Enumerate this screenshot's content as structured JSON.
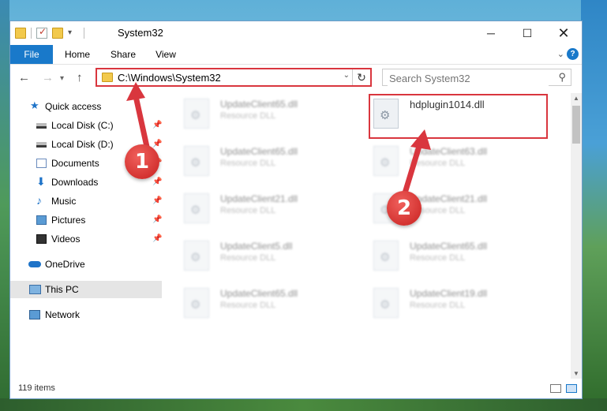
{
  "window": {
    "title": "System32",
    "quick_access_toolbar": [
      "folder-icon",
      "properties-icon",
      "new-folder-icon",
      "customize-icon"
    ]
  },
  "ribbon": {
    "tabs": [
      "File",
      "Home",
      "Share",
      "View"
    ],
    "help": "?"
  },
  "address": {
    "path": "C:\\Windows\\System32",
    "search_placeholder": "Search System32"
  },
  "nav": {
    "items": [
      {
        "label": "Quick access",
        "icon": "star-icon",
        "pinned": false
      },
      {
        "label": "Local Disk (C:)",
        "icon": "disk-icon",
        "pinned": true
      },
      {
        "label": "Local Disk (D:)",
        "icon": "disk-icon",
        "pinned": true
      },
      {
        "label": "Documents",
        "icon": "documents-icon",
        "pinned": true
      },
      {
        "label": "Downloads",
        "icon": "downloads-icon",
        "pinned": true
      },
      {
        "label": "Music",
        "icon": "music-icon",
        "pinned": true
      },
      {
        "label": "Pictures",
        "icon": "pictures-icon",
        "pinned": true
      },
      {
        "label": "Videos",
        "icon": "videos-icon",
        "pinned": true
      },
      {
        "label": "OneDrive",
        "icon": "onedrive-icon",
        "pinned": false
      },
      {
        "label": "This PC",
        "icon": "this-pc-icon",
        "pinned": false,
        "selected": true
      },
      {
        "label": "Network",
        "icon": "network-icon",
        "pinned": false
      }
    ]
  },
  "files": [
    {
      "name": "UpdateClient65.dll",
      "type": "Resource DLL"
    },
    {
      "name": "hdplugin1014.dll",
      "type": ""
    },
    {
      "name": "UpdateClient65.dll",
      "type": "Resource DLL"
    },
    {
      "name": "UpdateClient63.dll",
      "type": "Resource DLL"
    },
    {
      "name": "UpdateClient21.dll",
      "type": "Resource DLL"
    },
    {
      "name": "UpdateClient21.dll",
      "type": "Resource DLL"
    },
    {
      "name": "UpdateClient5.dll",
      "type": "Resource DLL"
    },
    {
      "name": "UpdateClient65.dll",
      "type": "Resource DLL"
    },
    {
      "name": "UpdateClient65.dll",
      "type": "Resource DLL"
    },
    {
      "name": "UpdateClient19.dll",
      "type": "Resource DLL"
    }
  ],
  "status": {
    "item_count": "119 items"
  },
  "callouts": [
    "1",
    "2"
  ],
  "colors": {
    "accent": "#1979ca",
    "highlight": "#d9363e"
  }
}
